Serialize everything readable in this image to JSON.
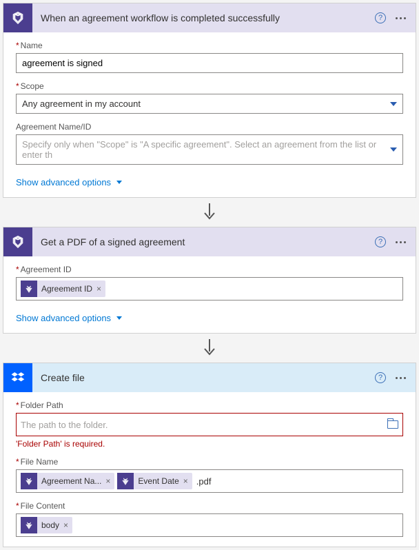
{
  "step1": {
    "title": "When an agreement workflow is completed successfully",
    "name_label": "Name",
    "name_value": "agreement is signed",
    "scope_label": "Scope",
    "scope_value": "Any agreement in my account",
    "agreement_label": "Agreement Name/ID",
    "agreement_placeholder": "Specify only when \"Scope\" is \"A specific agreement\". Select an agreement from the list or enter th",
    "advanced": "Show advanced options"
  },
  "step2": {
    "title": "Get a PDF of a signed agreement",
    "agreement_id_label": "Agreement ID",
    "token_agreement_id": "Agreement ID",
    "advanced": "Show advanced options"
  },
  "step3": {
    "title": "Create file",
    "folder_path_label": "Folder Path",
    "folder_path_placeholder": "The path to the folder.",
    "folder_path_error": "'Folder Path' is required.",
    "file_name_label": "File Name",
    "token_agreement_name": "Agreement Na...",
    "token_event_date": "Event Date",
    "file_name_suffix": ".pdf",
    "file_content_label": "File Content",
    "token_body": "body"
  }
}
